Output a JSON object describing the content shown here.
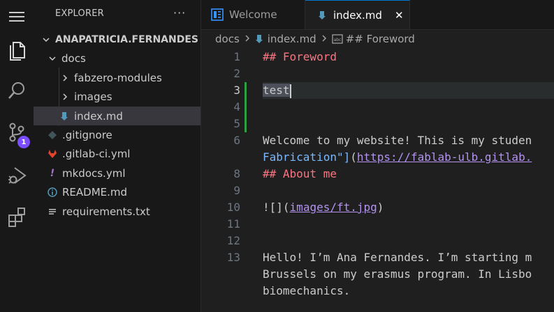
{
  "activity_bar": {
    "items": [
      {
        "icon": "menu-icon"
      },
      {
        "icon": "files-icon",
        "active": true
      },
      {
        "icon": "search-icon"
      },
      {
        "icon": "source-control-icon",
        "badge": "1"
      },
      {
        "icon": "run-debug-icon"
      },
      {
        "icon": "extensions-icon"
      }
    ],
    "badge_color": "#7c4dff"
  },
  "sidebar": {
    "title": "EXPLORER",
    "more": "···",
    "root": "ANAPATRICIA.FERNANDES",
    "tree": [
      {
        "label": "docs",
        "type": "folder-open",
        "depth": 1
      },
      {
        "label": "fabzero-modules",
        "type": "folder-closed",
        "depth": 2
      },
      {
        "label": "images",
        "type": "folder-closed",
        "depth": 2
      },
      {
        "label": "index.md",
        "type": "markdown",
        "depth": 2,
        "selected": true
      },
      {
        "label": ".gitignore",
        "type": "git",
        "depth": 1
      },
      {
        "label": ".gitlab-ci.yml",
        "type": "gitlab",
        "depth": 1
      },
      {
        "label": "mkdocs.yml",
        "type": "yaml",
        "depth": 1
      },
      {
        "label": "README.md",
        "type": "info",
        "depth": 1
      },
      {
        "label": "requirements.txt",
        "type": "text",
        "depth": 1
      }
    ]
  },
  "tabs": [
    {
      "label": "Welcome",
      "active": false
    },
    {
      "label": "index.md",
      "active": true,
      "close": "✕"
    }
  ],
  "breadcrumb": {
    "items": [
      "docs",
      "index.md",
      "## Foreword"
    ]
  },
  "editor": {
    "current_line": "3",
    "lines": [
      {
        "n": "1",
        "segments": [
          {
            "t": "## Foreword",
            "c": "head"
          }
        ]
      },
      {
        "n": "2",
        "segments": []
      },
      {
        "n": "3",
        "segments": [
          {
            "t": "test",
            "c": "sel"
          }
        ]
      },
      {
        "n": "4",
        "segments": []
      },
      {
        "n": "5",
        "segments": []
      },
      {
        "n": "6",
        "segments": [
          {
            "t": "Welcome to my website! This is my studen",
            "c": "plain"
          }
        ]
      },
      {
        "n": "",
        "segments": [
          {
            "t": "Fabrication\"]",
            "c": "linktext"
          },
          {
            "t": "(",
            "c": "punct"
          },
          {
            "t": "https://fablab-ulb.gitlab.",
            "c": "url"
          }
        ]
      },
      {
        "n": "8",
        "segments": [
          {
            "t": "## About me",
            "c": "head"
          }
        ]
      },
      {
        "n": "9",
        "segments": []
      },
      {
        "n": "10",
        "segments": [
          {
            "t": "![]",
            "c": "plain"
          },
          {
            "t": "(",
            "c": "punct"
          },
          {
            "t": "images/ft.jpg",
            "c": "url"
          },
          {
            "t": ")",
            "c": "punct"
          }
        ]
      },
      {
        "n": "11",
        "segments": []
      },
      {
        "n": "12",
        "segments": []
      },
      {
        "n": "13",
        "segments": [
          {
            "t": "Hello! I’m Ana Fernandes. I’m starting m",
            "c": "plain"
          }
        ]
      },
      {
        "n": "",
        "segments": [
          {
            "t": "Brussels on my erasmus program. In Lisbo",
            "c": "plain"
          }
        ]
      },
      {
        "n": "",
        "segments": [
          {
            "t": "biomechanics.",
            "c": "plain"
          }
        ]
      }
    ]
  },
  "colors": {
    "accent": "#0078d4",
    "md_heading": "#f97583",
    "md_link_text": "#79b8ff",
    "md_url": "#b392f0",
    "modified_gutter": "#2ea043"
  }
}
